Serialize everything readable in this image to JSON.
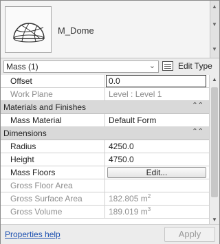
{
  "type_selector": {
    "type_name": "M_Dome",
    "preview_icon": "dome-icon"
  },
  "instance": {
    "selected": "Mass (1)",
    "edit_type_label": "Edit Type"
  },
  "properties": {
    "offset": {
      "name": "Offset",
      "value": "0.0"
    },
    "work_plane": {
      "name": "Work Plane",
      "value": "Level : Level 1"
    },
    "materials_section": "Materials and Finishes",
    "mass_material": {
      "name": "Mass Material",
      "value": "Default Form"
    },
    "dimensions_section": "Dimensions",
    "radius": {
      "name": "Radius",
      "value": "4250.0"
    },
    "height": {
      "name": "Height",
      "value": "4750.0"
    },
    "mass_floors": {
      "name": "Mass Floors",
      "button_label": "Edit..."
    },
    "gross_floor_area": {
      "name": "Gross Floor Area",
      "value": ""
    },
    "gross_surface_area": {
      "name": "Gross Surface Area",
      "value": "182.805 m",
      "unit_power": "2"
    },
    "gross_volume": {
      "name": "Gross Volume",
      "value": "189.019 m",
      "unit_power": "3"
    }
  },
  "footer": {
    "help_link": "Properties help",
    "apply_label": "Apply"
  }
}
